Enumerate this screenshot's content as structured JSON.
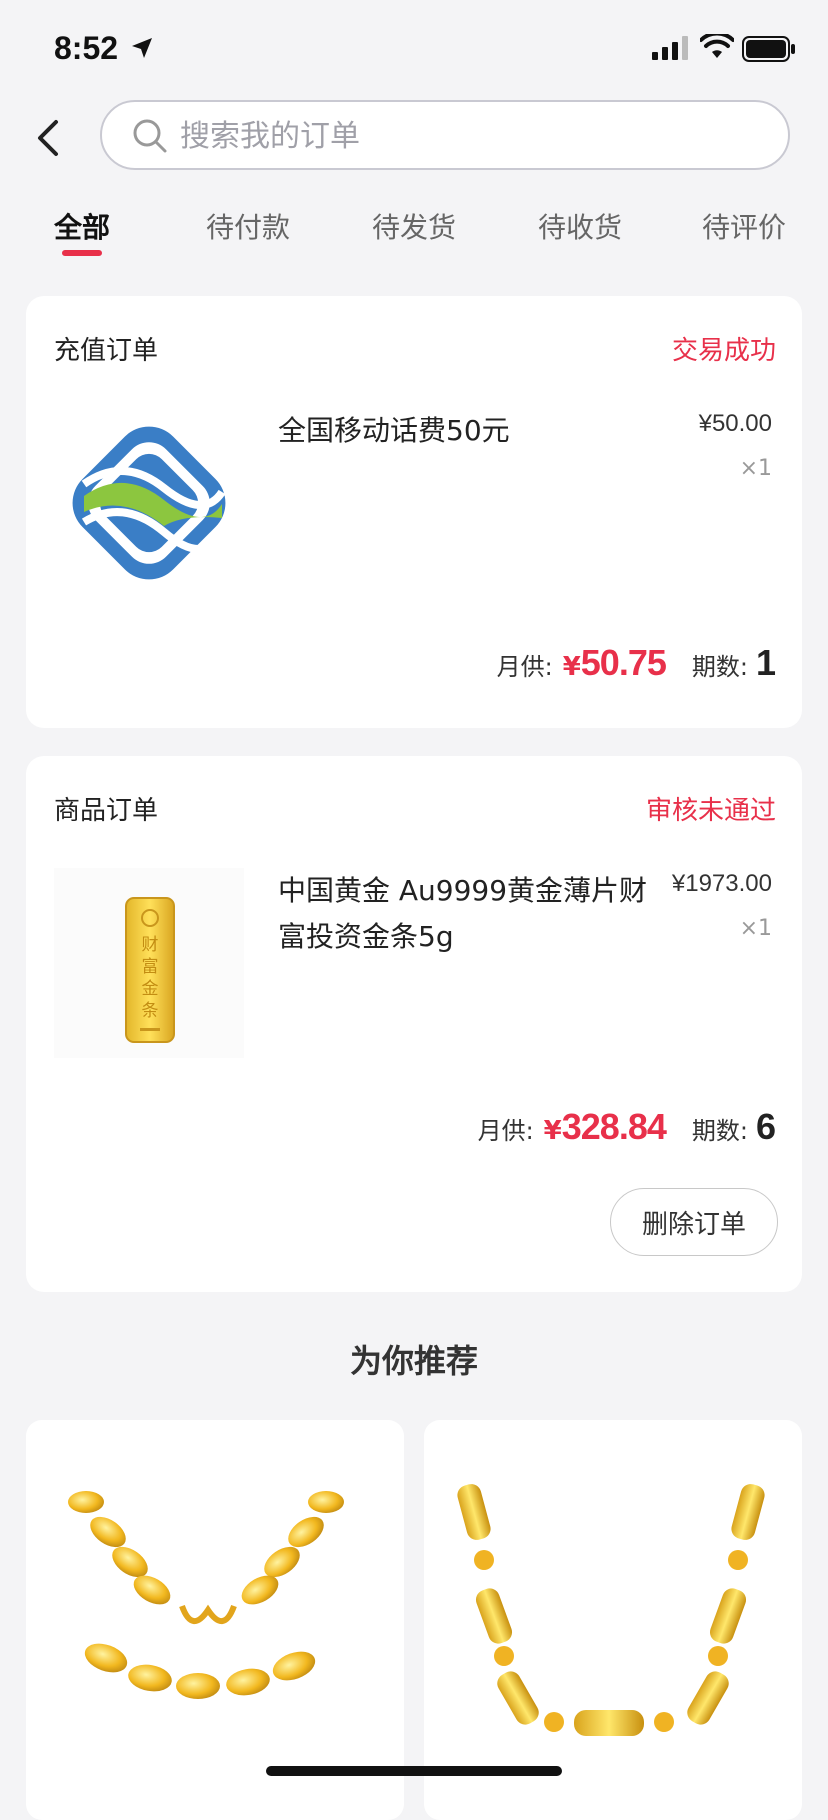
{
  "status_bar": {
    "time": "8:52"
  },
  "search": {
    "placeholder": "搜索我的订单"
  },
  "tabs": [
    {
      "label": "全部",
      "active": true
    },
    {
      "label": "待付款"
    },
    {
      "label": "待发货"
    },
    {
      "label": "待收货"
    },
    {
      "label": "待评价"
    }
  ],
  "orders": [
    {
      "type_label": "充值订单",
      "status": "交易成功",
      "product_name": "全国移动话费50元",
      "price": "¥50.00",
      "quantity": "×1",
      "monthly_label": "月供:",
      "currency": "¥",
      "monthly_amount": "50.75",
      "periods_label": "期数:",
      "periods": "1",
      "thumb_icon": "china-mobile-logo"
    },
    {
      "type_label": "商品订单",
      "status": "审核未通过",
      "product_name": "中国黄金 Au9999黄金薄片财富投资金条5g",
      "price": "¥1973.00",
      "quantity": "×1",
      "monthly_label": "月供:",
      "currency": "¥",
      "monthly_amount": "328.84",
      "periods_label": "期数:",
      "periods": "6",
      "delete_label": "删除订单",
      "thumb_icon": "gold-bar-image",
      "thumb_text": "财富金条"
    }
  ],
  "recommend": {
    "title": "为你推荐"
  },
  "colors": {
    "accent": "#e8304a",
    "background": "#f4f4f6"
  }
}
